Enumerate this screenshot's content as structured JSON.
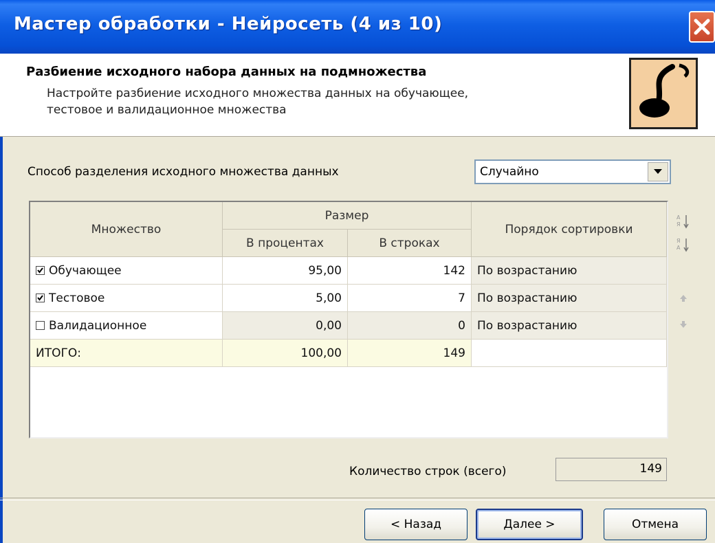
{
  "window": {
    "title": "Мастер обработки - Нейросеть (4 из 10)"
  },
  "header": {
    "title": "Разбиение исходного набора данных на подмножества",
    "description_line1": "Настройте разбиение исходного множества данных на обучающее,",
    "description_line2": "тестовое и валидационное множества"
  },
  "split": {
    "label": "Способ разделения исходного множества данных",
    "selected": "Случайно"
  },
  "table": {
    "headers": {
      "set": "Множество",
      "size": "Размер",
      "percent": "В процентах",
      "rows": "В строках",
      "sort": "Порядок сортировки"
    },
    "rows": [
      {
        "name": "Обучающее",
        "checked": true,
        "percent": "95,00",
        "rows": "142",
        "sort": "По возрастанию"
      },
      {
        "name": "Тестовое",
        "checked": true,
        "percent": "5,00",
        "rows": "7",
        "sort": "По возрастанию"
      },
      {
        "name": "Валидационное",
        "checked": false,
        "percent": "0,00",
        "rows": "0",
        "sort": "По возрастанию"
      }
    ],
    "total": {
      "label": "ИТОГО:",
      "percent": "100,00",
      "rows": "149",
      "sort": ""
    }
  },
  "summary": {
    "label": "Количество строк (всего)",
    "value": "149"
  },
  "buttons": {
    "back": "< Назад",
    "next": "Далее >",
    "cancel": "Отмена"
  },
  "tools": {
    "sort_asc": "sort-ascending-icon",
    "sort_desc": "sort-descending-icon",
    "up": "arrow-up-icon",
    "down": "arrow-down-icon"
  }
}
